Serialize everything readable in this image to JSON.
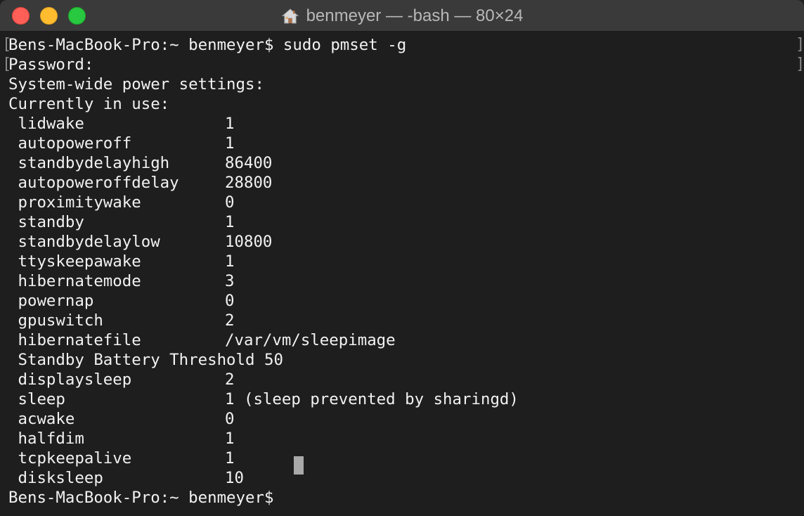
{
  "window": {
    "title": "benmeyer — -bash — 80×24"
  },
  "terminal": {
    "prompt_line": "Bens-MacBook-Pro:~ benmeyer$ sudo pmset -g",
    "password_line": "Password:",
    "header1": "System-wide power settings:",
    "header2": "Currently in use:",
    "settings": [
      {
        "key": " lidwake",
        "value": "1"
      },
      {
        "key": " autopoweroff",
        "value": "1"
      },
      {
        "key": " standbydelayhigh",
        "value": "86400"
      },
      {
        "key": " autopoweroffdelay",
        "value": "28800"
      },
      {
        "key": " proximitywake",
        "value": "0"
      },
      {
        "key": " standby",
        "value": "1"
      },
      {
        "key": " standbydelaylow",
        "value": "10800"
      },
      {
        "key": " ttyskeepawake",
        "value": "1"
      },
      {
        "key": " hibernatemode",
        "value": "3"
      },
      {
        "key": " powernap",
        "value": "0"
      },
      {
        "key": " gpuswitch",
        "value": "2"
      },
      {
        "key": " hibernatefile",
        "value": "/var/vm/sleepimage"
      },
      {
        "key": " Standby Battery Threshold 50",
        "value": ""
      },
      {
        "key": " displaysleep",
        "value": "2"
      },
      {
        "key": " sleep",
        "value": "1 (sleep prevented by sharingd)"
      },
      {
        "key": " acwake",
        "value": "0"
      },
      {
        "key": " halfdim",
        "value": "1"
      },
      {
        "key": " tcpkeepalive",
        "value": "1"
      },
      {
        "key": " disksleep",
        "value": "10"
      }
    ],
    "final_prompt": "Bens-MacBook-Pro:~ benmeyer$",
    "open_bracket": "[",
    "close_bracket": "]"
  },
  "colors": {
    "background": "#1e1e1e",
    "text": "#f2f2f2",
    "titlebar": "#3a3a3a",
    "close": "#ff5f57",
    "minimize": "#febc2e",
    "zoom": "#28c840"
  },
  "icons": {
    "title_icon": "home-icon"
  }
}
